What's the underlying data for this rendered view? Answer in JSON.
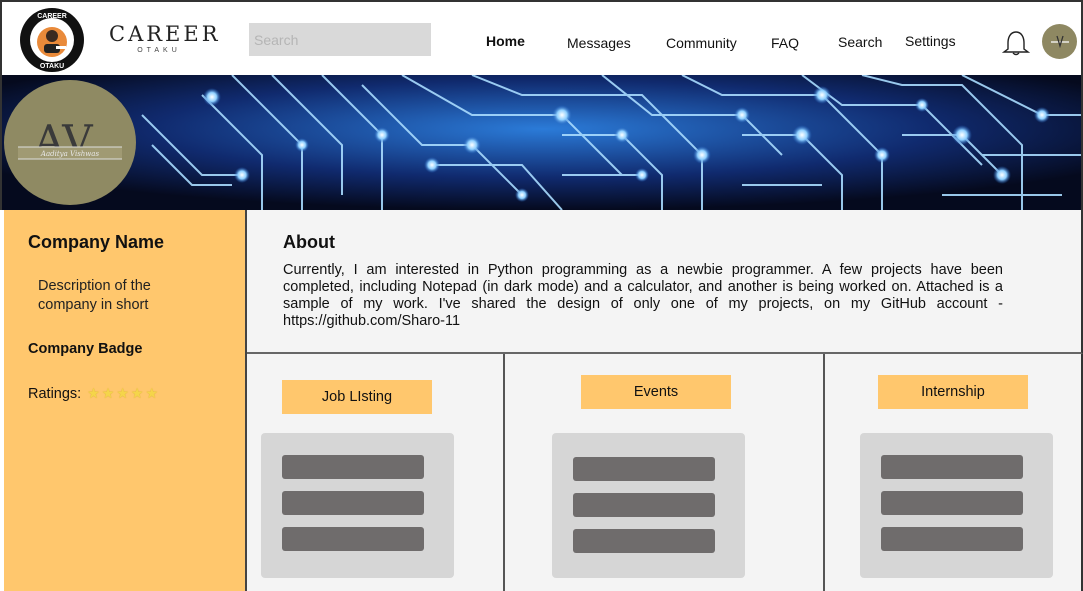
{
  "header": {
    "logo_text_top": "CAREER",
    "logo_text_bottom": "OTAKU",
    "brand_main": "CAREER",
    "brand_sub": "OTAKU",
    "search_placeholder": "Search",
    "nav": [
      {
        "label": "Home",
        "active": true
      },
      {
        "label": "Messages",
        "active": false
      },
      {
        "label": "Community",
        "active": false
      },
      {
        "label": "FAQ",
        "active": false
      },
      {
        "label": "Search",
        "active": false
      },
      {
        "label": "Settings",
        "active": false
      }
    ],
    "notification_icon": "bell-icon",
    "avatar_icon": "user-avatar"
  },
  "profile": {
    "initials": "AV",
    "signature": "Aaditya Vishwas"
  },
  "sidebar": {
    "company_name": "Company Name",
    "description": "Description of the company in short",
    "badge_label": "Company Badge",
    "ratings_label": "Ratings:",
    "rating_value": 5,
    "rating_max": 5
  },
  "about": {
    "title": "About",
    "text": "Currently, I am interested in Python programming as a newbie programmer. A few projects have been completed, including Notepad (in dark mode) and a calculator, and another is being worked on. Attached is a sample of my work. I've shared the design of only one of my projects, on my GitHub account - https://github.com/Sharo-11"
  },
  "sections": [
    {
      "label": "Job LIsting",
      "items": 3
    },
    {
      "label": "Events",
      "items": 3
    },
    {
      "label": "Internship",
      "items": 3
    }
  ],
  "colors": {
    "accent": "#ffc76d",
    "placeholder_bar": "#6f6c6c",
    "card": "#d6d6d6",
    "avatar": "#8f8a63"
  }
}
